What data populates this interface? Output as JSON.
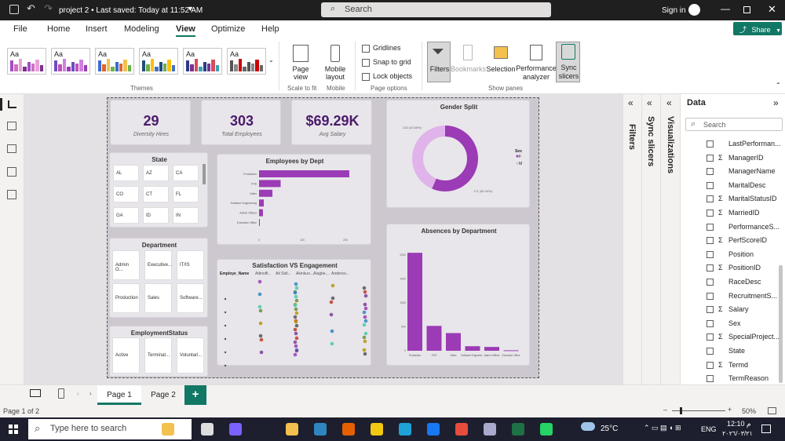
{
  "titlebar": {
    "title": "project 2 • Last saved: Today at 11:52 AM",
    "search_placeholder": "Search",
    "sign_in": "Sign in"
  },
  "menu": {
    "items": [
      "File",
      "Home",
      "Insert",
      "Modeling",
      "View",
      "Optimize",
      "Help"
    ],
    "active": "View",
    "share": "Share"
  },
  "ribbon": {
    "themes_label": "Themes",
    "aa": "Aa",
    "page_view": "Page view",
    "scale_label": "Scale to fit",
    "mobile_layout": "Mobile layout",
    "mobile_label": "Mobile",
    "gridlines": "Gridlines",
    "snap": "Snap to grid",
    "lock": "Lock objects",
    "page_options_label": "Page options",
    "filters": "Filters",
    "bookmarks": "Bookmarks",
    "selection": "Selection",
    "performance": "Performance analyzer",
    "sync": "Sync slicers",
    "show_panes_label": "Show panes"
  },
  "kpis": [
    {
      "value": "29",
      "label": "Diversity Hires"
    },
    {
      "value": "303",
      "label": "Total Employees"
    },
    {
      "value": "$69.29K",
      "label": "Avg Salary"
    }
  ],
  "state_slicer": {
    "title": "State",
    "items": [
      "AL",
      "AZ",
      "CA",
      "CO",
      "CT",
      "FL",
      "GA",
      "ID",
      "IN"
    ]
  },
  "department_slicer": {
    "title": "Department",
    "items": [
      "Admin O...",
      "Executive...",
      "IT/IS",
      "Production",
      "Sales",
      "Software..."
    ]
  },
  "employment_slicer": {
    "title": "EmploymentStatus",
    "items": [
      "Active",
      "Terminat...",
      "Voluntari..."
    ]
  },
  "charts": {
    "dept": {
      "title": "Employees by Dept",
      "cats": [
        "Production",
        "IT/IS",
        "Sales",
        "Software Engineering",
        "Admin Offices",
        "Executive Office"
      ],
      "values": [
        209,
        50,
        31,
        11,
        9,
        1
      ],
      "ticks": [
        "0",
        "100",
        "200"
      ]
    },
    "gender": {
      "title": "Gender Split",
      "legend_title": "Sex",
      "legend": [
        "F",
        "M"
      ],
      "left_label": "132 (43.56%)",
      "right_label": "171 (56.44%)",
      "values": [
        132,
        171
      ]
    },
    "absence": {
      "title": "Absences by Department",
      "cats": [
        "Production",
        "IT/IS",
        "Sales",
        "Software Engineeri...",
        "Admin Offices",
        "Executive Office"
      ],
      "values": [
        2050,
        520,
        370,
        95,
        80,
        10
      ],
      "ticks": [
        "0",
        "500",
        "1000",
        "1500",
        "2000"
      ]
    },
    "scatter": {
      "title": "Satisfaction VS Engagement",
      "legend_label": "Employe_Name",
      "legend": [
        "Adinolfi...",
        "Ait Sidi...",
        "Akinkuo...",
        "Alagbe,...",
        "Anderso..."
      ]
    }
  },
  "colors": {
    "accent": "#9b3bb5",
    "accent_light": "#e0b3ea",
    "brand": "#117865"
  },
  "right": {
    "filters": "Filters",
    "sync": "Sync slicers",
    "viz": "Visualizations",
    "data": "Data",
    "search_placeholder": "Search",
    "fields": [
      {
        "name": "LastPerforman...",
        "sigma": false
      },
      {
        "name": "ManagerID",
        "sigma": true
      },
      {
        "name": "ManagerName",
        "sigma": false
      },
      {
        "name": "MaritalDesc",
        "sigma": false
      },
      {
        "name": "MaritalStatusID",
        "sigma": true
      },
      {
        "name": "MarriedID",
        "sigma": true
      },
      {
        "name": "PerformanceS...",
        "sigma": false
      },
      {
        "name": "PerfScoreID",
        "sigma": true
      },
      {
        "name": "Position",
        "sigma": false
      },
      {
        "name": "PositionID",
        "sigma": true
      },
      {
        "name": "RaceDesc",
        "sigma": false
      },
      {
        "name": "RecruitmentS...",
        "sigma": false
      },
      {
        "name": "Salary",
        "sigma": true
      },
      {
        "name": "Sex",
        "sigma": false
      },
      {
        "name": "SpecialProject...",
        "sigma": true
      },
      {
        "name": "State",
        "sigma": false
      },
      {
        "name": "Termd",
        "sigma": true
      },
      {
        "name": "TermReason",
        "sigma": false
      },
      {
        "name": "Zip",
        "sigma": true
      }
    ]
  },
  "tabs": {
    "pages": [
      "Page 1",
      "Page 2"
    ],
    "add": "+"
  },
  "status": {
    "page": "Page 1 of 2",
    "zoom": "50%"
  },
  "taskbar": {
    "search_placeholder": "Type here to search",
    "temp": "25°C",
    "lang": "ENG",
    "time": "12:10 م",
    "date": "٢٠٢٦/٠٣/٢١"
  }
}
